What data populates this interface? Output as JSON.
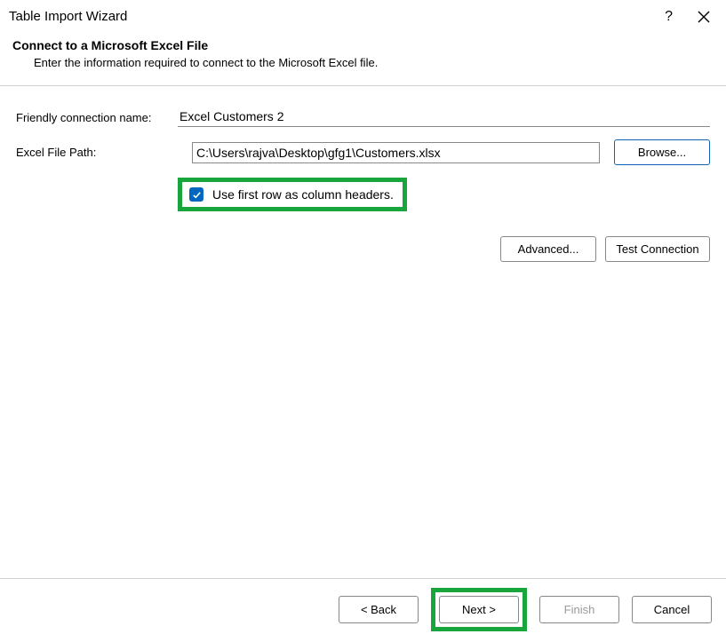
{
  "title": "Table Import Wizard",
  "header": {
    "bold": "Connect to a Microsoft Excel File",
    "sub": "Enter the information required to connect to the Microsoft Excel file."
  },
  "form": {
    "friendly_label": "Friendly connection name:",
    "friendly_value": "Excel Customers 2",
    "filepath_label": "Excel File Path:",
    "filepath_value": "C:\\Users\\rajva\\Desktop\\gfg1\\Customers.xlsx",
    "browse_label": "Browse...",
    "checkbox_label": "Use first row as column headers."
  },
  "secondary": {
    "advanced": "Advanced...",
    "test": "Test Connection"
  },
  "footer": {
    "back": "< Back",
    "next": "Next >",
    "finish": "Finish",
    "cancel": "Cancel"
  }
}
